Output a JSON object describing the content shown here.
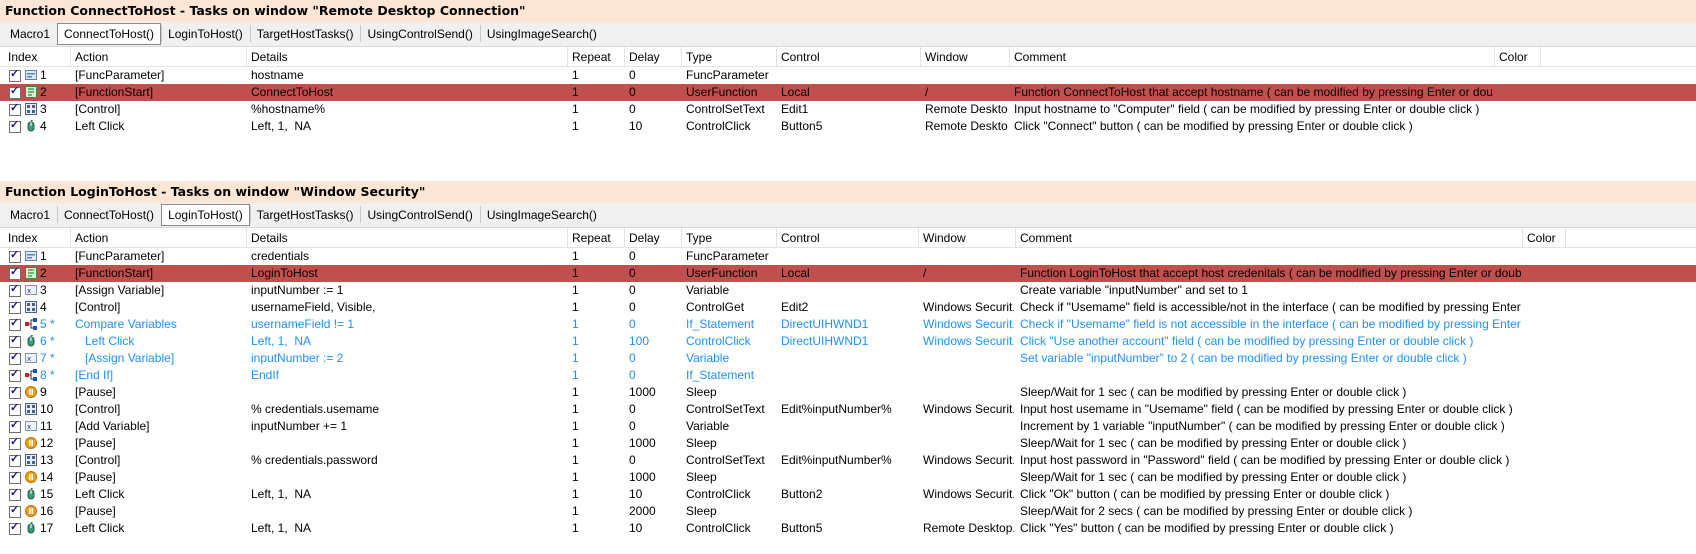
{
  "panels": [
    {
      "title": "Function ConnectToHost - Tasks on window \"Remote Desktop Connection\"",
      "tabs": [
        "Macro1",
        "ConnectToHost()",
        "LoginToHost()",
        "TargetHostTasks()",
        "UsingControlSend()",
        "UsingImageSearch()"
      ],
      "active_tab": 1,
      "headers": {
        "index": "Index",
        "action": "Action",
        "details": "Details",
        "repeat": "Repeat",
        "delay": "Delay",
        "type": "Type",
        "control": "Control",
        "window": "Window",
        "comment": "Comment",
        "color": "Color"
      },
      "rows": [
        {
          "index": "1",
          "action": "[FuncParameter]",
          "details": "hostname",
          "repeat": "1",
          "delay": "0",
          "type": "FuncParameter",
          "control": "",
          "window": "",
          "comment": "",
          "icon": "parameter-icon"
        },
        {
          "index": "2",
          "action": "[FunctionStart]",
          "details": "ConnectToHost",
          "repeat": "1",
          "delay": "0",
          "type": "UserFunction",
          "control": "Local",
          "window": "/",
          "comment": "Function ConnectToHost that accept hostname ( can be modified by pressing Enter or double click )",
          "icon": "function-icon",
          "selected": true
        },
        {
          "index": "3",
          "action": "[Control]",
          "details": "%hostname%",
          "repeat": "1",
          "delay": "0",
          "type": "ControlSetText",
          "control": "Edit1",
          "window": "Remote Deskto...",
          "comment": "Input hostname to \"Computer\" field ( can be modified by pressing Enter or double click )",
          "icon": "control-icon"
        },
        {
          "index": "4",
          "action": "Left Click",
          "details": "Left, 1,  NA",
          "repeat": "1",
          "delay": "10",
          "type": "ControlClick",
          "control": "Button5",
          "window": "Remote Deskto...",
          "comment": "Click \"Connect\" button ( can be modified by pressing Enter or double click )",
          "icon": "mouse-icon"
        }
      ]
    },
    {
      "title": "Function LoginToHost - Tasks on window \"Window Security\"",
      "tabs": [
        "Macro1",
        "ConnectToHost()",
        "LoginToHost()",
        "TargetHostTasks()",
        "UsingControlSend()",
        "UsingImageSearch()"
      ],
      "active_tab": 2,
      "headers": {
        "index": "Index",
        "action": "Action",
        "details": "Details",
        "repeat": "Repeat",
        "delay": "Delay",
        "type": "Type",
        "control": "Control",
        "window": "Window",
        "comment": "Comment",
        "color": "Color"
      },
      "rows": [
        {
          "index": "1",
          "action": "[FuncParameter]",
          "details": "credentials",
          "repeat": "1",
          "delay": "0",
          "type": "FuncParameter",
          "control": "",
          "window": "",
          "comment": "",
          "icon": "parameter-icon"
        },
        {
          "index": "2",
          "action": "[FunctionStart]",
          "details": "LoginToHost",
          "repeat": "1",
          "delay": "0",
          "type": "UserFunction",
          "control": "Local",
          "window": "/",
          "comment": "Function LoginToHost that accept host credenitals ( can be modified by pressing Enter or double click )",
          "icon": "function-icon",
          "selected": true
        },
        {
          "index": "3",
          "action": "[Assign Variable]",
          "details": "inputNumber := 1",
          "repeat": "1",
          "delay": "0",
          "type": "Variable",
          "control": "",
          "window": "",
          "comment": "Create variable \"inputNumber\" and set to 1",
          "icon": "variable-icon"
        },
        {
          "index": "4",
          "action": "[Control]",
          "details": "usernameField, Visible,",
          "repeat": "1",
          "delay": "0",
          "type": "ControlGet",
          "control": "Edit2",
          "window": "Windows Securit...",
          "comment": "Check if \"Usemame\" field is accessible/not in the interface ( can be modified by pressing Enter or double click )",
          "icon": "control-icon"
        },
        {
          "index": "5 *",
          "action": "Compare Variables",
          "details": "usernameField != 1",
          "repeat": "1",
          "delay": "0",
          "type": "If_Statement",
          "control": "DirectUIHWND1",
          "window": "Windows Securit...",
          "comment": "Check if \"Usemame\" field is not accessible in the interface ( can be modified by pressing Enter or double click )",
          "icon": "if-icon",
          "blue": true
        },
        {
          "index": "6 *",
          "action": "   Left Click",
          "details": "Left, 1,  NA",
          "repeat": "1",
          "delay": "100",
          "type": "ControlClick",
          "control": "DirectUIHWND1",
          "window": "Windows Securit...",
          "comment": "Click \"Use another account\" field ( can be modified by pressing Enter or double click )",
          "icon": "mouse-icon",
          "blue": true
        },
        {
          "index": "7 *",
          "action": "   [Assign Variable]",
          "details": "inputNumber := 2",
          "repeat": "1",
          "delay": "0",
          "type": "Variable",
          "control": "",
          "window": "",
          "comment": "Set variable \"inputNumber\" to 2 ( can be modified by pressing Enter or double click )",
          "icon": "variable-icon",
          "blue": true
        },
        {
          "index": "8 *",
          "action": "[End If]",
          "details": "EndIf",
          "repeat": "1",
          "delay": "0",
          "type": "If_Statement",
          "control": "",
          "window": "",
          "comment": "",
          "icon": "if-icon",
          "blue": true
        },
        {
          "index": "9",
          "action": "[Pause]",
          "details": "",
          "repeat": "1",
          "delay": "1000",
          "type": "Sleep",
          "control": "",
          "window": "",
          "comment": "Sleep/Wait for 1 sec ( can be modified by pressing Enter or double click )",
          "icon": "pause-icon"
        },
        {
          "index": "10",
          "action": "[Control]",
          "details": "% credentials.usemame",
          "repeat": "1",
          "delay": "0",
          "type": "ControlSetText",
          "control": "Edit%inputNumber%",
          "window": "Windows Securit...",
          "comment": "Input host usemame in \"Usemame\" field ( can be modified by pressing Enter or double click )",
          "icon": "control-icon"
        },
        {
          "index": "11",
          "action": "[Add Variable]",
          "details": "inputNumber += 1",
          "repeat": "1",
          "delay": "0",
          "type": "Variable",
          "control": "",
          "window": "",
          "comment": "Increment by 1 variable \"inputNumber\" ( can be modified by pressing Enter or double click )",
          "icon": "variable-icon"
        },
        {
          "index": "12",
          "action": "[Pause]",
          "details": "",
          "repeat": "1",
          "delay": "1000",
          "type": "Sleep",
          "control": "",
          "window": "",
          "comment": "Sleep/Wait for 1 sec ( can be modified by pressing Enter or double click )",
          "icon": "pause-icon"
        },
        {
          "index": "13",
          "action": "[Control]",
          "details": "% credentials.password",
          "repeat": "1",
          "delay": "0",
          "type": "ControlSetText",
          "control": "Edit%inputNumber%",
          "window": "Windows Securit...",
          "comment": "Input host password in \"Password\" field ( can be modified by pressing Enter or double click )",
          "icon": "control-icon"
        },
        {
          "index": "14",
          "action": "[Pause]",
          "details": "",
          "repeat": "1",
          "delay": "1000",
          "type": "Sleep",
          "control": "",
          "window": "",
          "comment": "Sleep/Wait for 1 sec ( can be modified by pressing Enter or double click )",
          "icon": "pause-icon"
        },
        {
          "index": "15",
          "action": "Left Click",
          "details": "Left, 1,  NA",
          "repeat": "1",
          "delay": "10",
          "type": "ControlClick",
          "control": "Button2",
          "window": "Windows Securit...",
          "comment": "Click \"Ok\" button ( can be modified by pressing Enter or double click )",
          "icon": "mouse-icon"
        },
        {
          "index": "16",
          "action": "[Pause]",
          "details": "",
          "repeat": "1",
          "delay": "2000",
          "type": "Sleep",
          "control": "",
          "window": "",
          "comment": "Sleep/Wait for 2 secs ( can be modified by pressing Enter or double click )",
          "icon": "pause-icon"
        },
        {
          "index": "17",
          "action": "Left Click",
          "details": "Left, 1,  NA",
          "repeat": "1",
          "delay": "10",
          "type": "ControlClick",
          "control": "Button5",
          "window": "Remote Desktop...",
          "comment": "Click \"Yes\" button ( can be modified by pressing Enter or double click )",
          "icon": "mouse-icon"
        }
      ]
    }
  ],
  "colors": {
    "title_bg": "#fbe5d4",
    "selected_row": "#c0504d",
    "nested_text": "#1e90ff"
  }
}
